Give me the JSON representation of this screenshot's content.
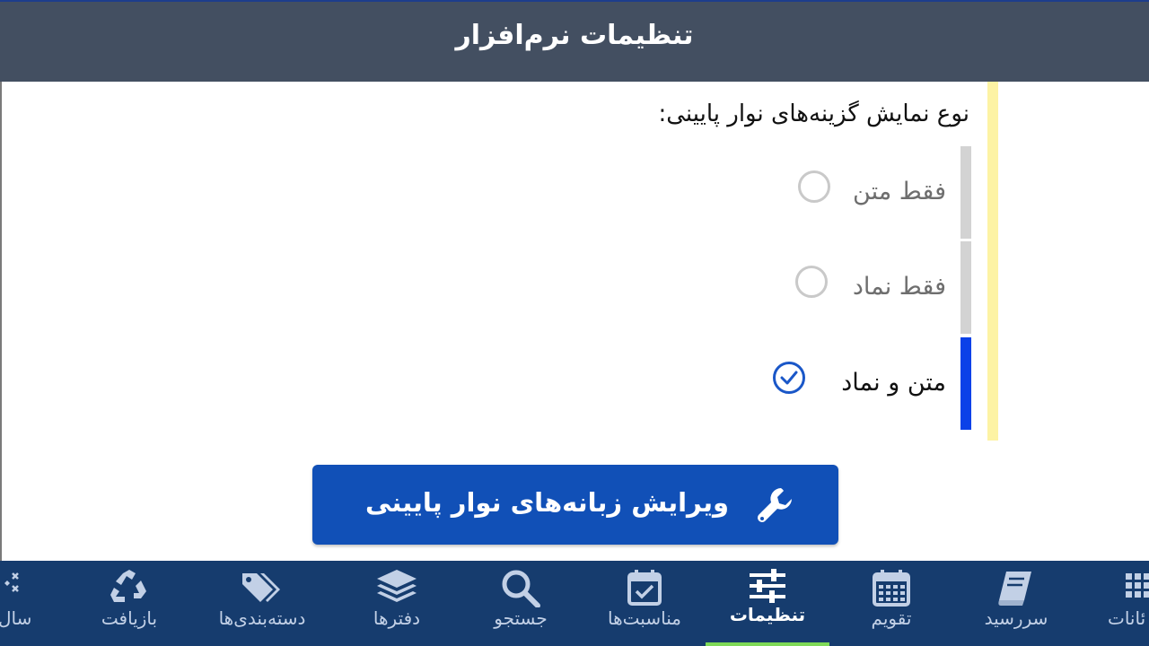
{
  "header": {
    "title": "تنظیمات نرم‌افزار"
  },
  "bottom_bar_setting": {
    "label": "نوع نمایش گزینه‌های نوار پایینی:",
    "options": [
      {
        "label": "فقط متن",
        "selected": false
      },
      {
        "label": "فقط نماد",
        "selected": false
      },
      {
        "label": "متن و نماد",
        "selected": true
      }
    ]
  },
  "edit_tabs_button": {
    "label": "ویرایش زبانه‌های نوار پایینی"
  },
  "nav": {
    "items": [
      {
        "label": "سال",
        "icon": "sparkle-icon"
      },
      {
        "label": "بازیافت",
        "icon": "recycle-icon"
      },
      {
        "label": "دسته‌بندی‌ها",
        "icon": "tags-icon"
      },
      {
        "label": "دفترها",
        "icon": "layers-icon"
      },
      {
        "label": "جستجو",
        "icon": "search-icon"
      },
      {
        "label": "مناسبت‌ها",
        "icon": "calendar-check-icon"
      },
      {
        "label": "تنظیمات",
        "icon": "sliders-icon",
        "active": true
      },
      {
        "label": "تقویم",
        "icon": "calendar-icon"
      },
      {
        "label": "سررسید",
        "icon": "book-icon"
      },
      {
        "label": "ئانات",
        "icon": "grid-icon"
      }
    ]
  },
  "colors": {
    "header_bg": "#434f61",
    "nav_bg": "#163c6e",
    "accent_blue": "#1150b7",
    "selected_bar": "#0b41e8",
    "unselected_bar": "#d3d3d3",
    "section_marker": "#fdf3a4",
    "active_tab_underline": "#7ed957"
  }
}
